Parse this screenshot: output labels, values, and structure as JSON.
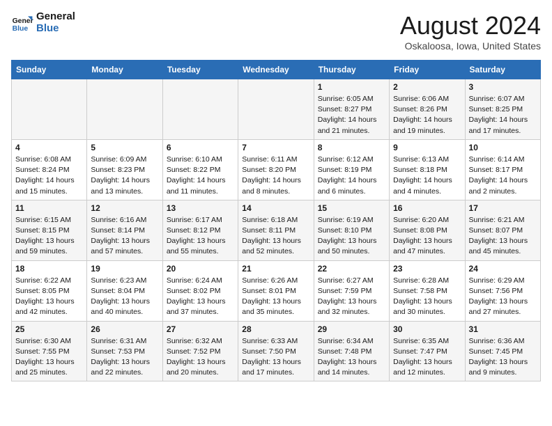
{
  "header": {
    "logo_line1": "General",
    "logo_line2": "Blue",
    "month_year": "August 2024",
    "location": "Oskaloosa, Iowa, United States"
  },
  "days_of_week": [
    "Sunday",
    "Monday",
    "Tuesday",
    "Wednesday",
    "Thursday",
    "Friday",
    "Saturday"
  ],
  "weeks": [
    [
      {
        "num": "",
        "info": ""
      },
      {
        "num": "",
        "info": ""
      },
      {
        "num": "",
        "info": ""
      },
      {
        "num": "",
        "info": ""
      },
      {
        "num": "1",
        "info": "Sunrise: 6:05 AM\nSunset: 8:27 PM\nDaylight: 14 hours\nand 21 minutes."
      },
      {
        "num": "2",
        "info": "Sunrise: 6:06 AM\nSunset: 8:26 PM\nDaylight: 14 hours\nand 19 minutes."
      },
      {
        "num": "3",
        "info": "Sunrise: 6:07 AM\nSunset: 8:25 PM\nDaylight: 14 hours\nand 17 minutes."
      }
    ],
    [
      {
        "num": "4",
        "info": "Sunrise: 6:08 AM\nSunset: 8:24 PM\nDaylight: 14 hours\nand 15 minutes."
      },
      {
        "num": "5",
        "info": "Sunrise: 6:09 AM\nSunset: 8:23 PM\nDaylight: 14 hours\nand 13 minutes."
      },
      {
        "num": "6",
        "info": "Sunrise: 6:10 AM\nSunset: 8:22 PM\nDaylight: 14 hours\nand 11 minutes."
      },
      {
        "num": "7",
        "info": "Sunrise: 6:11 AM\nSunset: 8:20 PM\nDaylight: 14 hours\nand 8 minutes."
      },
      {
        "num": "8",
        "info": "Sunrise: 6:12 AM\nSunset: 8:19 PM\nDaylight: 14 hours\nand 6 minutes."
      },
      {
        "num": "9",
        "info": "Sunrise: 6:13 AM\nSunset: 8:18 PM\nDaylight: 14 hours\nand 4 minutes."
      },
      {
        "num": "10",
        "info": "Sunrise: 6:14 AM\nSunset: 8:17 PM\nDaylight: 14 hours\nand 2 minutes."
      }
    ],
    [
      {
        "num": "11",
        "info": "Sunrise: 6:15 AM\nSunset: 8:15 PM\nDaylight: 13 hours\nand 59 minutes."
      },
      {
        "num": "12",
        "info": "Sunrise: 6:16 AM\nSunset: 8:14 PM\nDaylight: 13 hours\nand 57 minutes."
      },
      {
        "num": "13",
        "info": "Sunrise: 6:17 AM\nSunset: 8:12 PM\nDaylight: 13 hours\nand 55 minutes."
      },
      {
        "num": "14",
        "info": "Sunrise: 6:18 AM\nSunset: 8:11 PM\nDaylight: 13 hours\nand 52 minutes."
      },
      {
        "num": "15",
        "info": "Sunrise: 6:19 AM\nSunset: 8:10 PM\nDaylight: 13 hours\nand 50 minutes."
      },
      {
        "num": "16",
        "info": "Sunrise: 6:20 AM\nSunset: 8:08 PM\nDaylight: 13 hours\nand 47 minutes."
      },
      {
        "num": "17",
        "info": "Sunrise: 6:21 AM\nSunset: 8:07 PM\nDaylight: 13 hours\nand 45 minutes."
      }
    ],
    [
      {
        "num": "18",
        "info": "Sunrise: 6:22 AM\nSunset: 8:05 PM\nDaylight: 13 hours\nand 42 minutes."
      },
      {
        "num": "19",
        "info": "Sunrise: 6:23 AM\nSunset: 8:04 PM\nDaylight: 13 hours\nand 40 minutes."
      },
      {
        "num": "20",
        "info": "Sunrise: 6:24 AM\nSunset: 8:02 PM\nDaylight: 13 hours\nand 37 minutes."
      },
      {
        "num": "21",
        "info": "Sunrise: 6:26 AM\nSunset: 8:01 PM\nDaylight: 13 hours\nand 35 minutes."
      },
      {
        "num": "22",
        "info": "Sunrise: 6:27 AM\nSunset: 7:59 PM\nDaylight: 13 hours\nand 32 minutes."
      },
      {
        "num": "23",
        "info": "Sunrise: 6:28 AM\nSunset: 7:58 PM\nDaylight: 13 hours\nand 30 minutes."
      },
      {
        "num": "24",
        "info": "Sunrise: 6:29 AM\nSunset: 7:56 PM\nDaylight: 13 hours\nand 27 minutes."
      }
    ],
    [
      {
        "num": "25",
        "info": "Sunrise: 6:30 AM\nSunset: 7:55 PM\nDaylight: 13 hours\nand 25 minutes."
      },
      {
        "num": "26",
        "info": "Sunrise: 6:31 AM\nSunset: 7:53 PM\nDaylight: 13 hours\nand 22 minutes."
      },
      {
        "num": "27",
        "info": "Sunrise: 6:32 AM\nSunset: 7:52 PM\nDaylight: 13 hours\nand 20 minutes."
      },
      {
        "num": "28",
        "info": "Sunrise: 6:33 AM\nSunset: 7:50 PM\nDaylight: 13 hours\nand 17 minutes."
      },
      {
        "num": "29",
        "info": "Sunrise: 6:34 AM\nSunset: 7:48 PM\nDaylight: 13 hours\nand 14 minutes."
      },
      {
        "num": "30",
        "info": "Sunrise: 6:35 AM\nSunset: 7:47 PM\nDaylight: 13 hours\nand 12 minutes."
      },
      {
        "num": "31",
        "info": "Sunrise: 6:36 AM\nSunset: 7:45 PM\nDaylight: 13 hours\nand 9 minutes."
      }
    ]
  ]
}
